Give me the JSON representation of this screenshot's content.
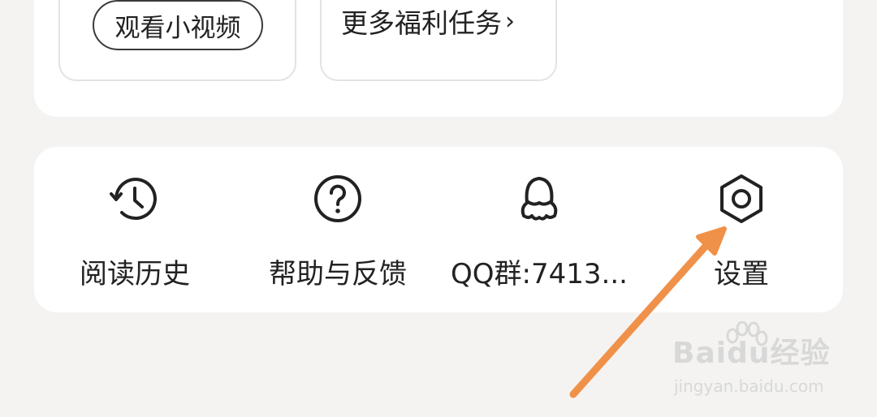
{
  "welfare": {
    "watch_video_label": "观看小视频",
    "more_tasks_label": "更多福利任务",
    "more_tasks_chevron": "›"
  },
  "menu": {
    "items": [
      {
        "label": "阅读历史",
        "icon": "history-clock-icon"
      },
      {
        "label": "帮助与反馈",
        "icon": "help-question-icon"
      },
      {
        "label": "QQ群:7413...",
        "icon": "qq-penguin-icon"
      },
      {
        "label": "设置",
        "icon": "settings-gear-icon"
      }
    ]
  },
  "watermark": {
    "brand": "Baidu经验",
    "url": "jingyan.baidu.com"
  },
  "colors": {
    "background": "#f4f3f1",
    "card": "#ffffff",
    "annotation_arrow": "#f0914a"
  }
}
